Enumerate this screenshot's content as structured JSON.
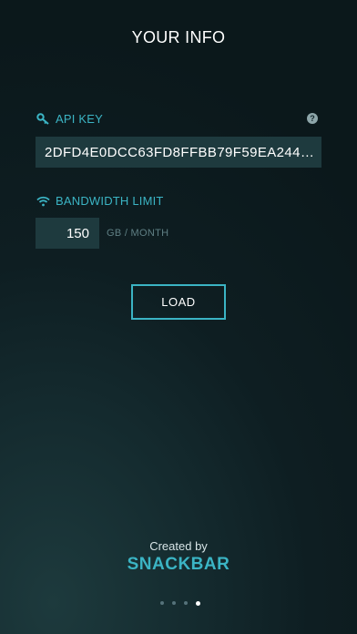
{
  "header": {
    "title": "YOUR INFO"
  },
  "api_key": {
    "label": "API KEY",
    "icon": "key-icon",
    "help_icon": "help-icon",
    "help_glyph": "?",
    "value": "2DFD4E0DCC63FD8FFBB79F59EA244…"
  },
  "bandwidth": {
    "label": "BANDWIDTH LIMIT",
    "icon": "wifi-icon",
    "value": "150",
    "unit": "GB / MONTH"
  },
  "actions": {
    "load_label": "LOAD"
  },
  "footer": {
    "credit": "Created by",
    "brand": "SNACKBAR"
  },
  "pager": {
    "total": 4,
    "current": 4
  },
  "colors": {
    "accent": "#3bb4c4",
    "field_bg": "#1e3a3e",
    "background": "#0e1e22"
  }
}
